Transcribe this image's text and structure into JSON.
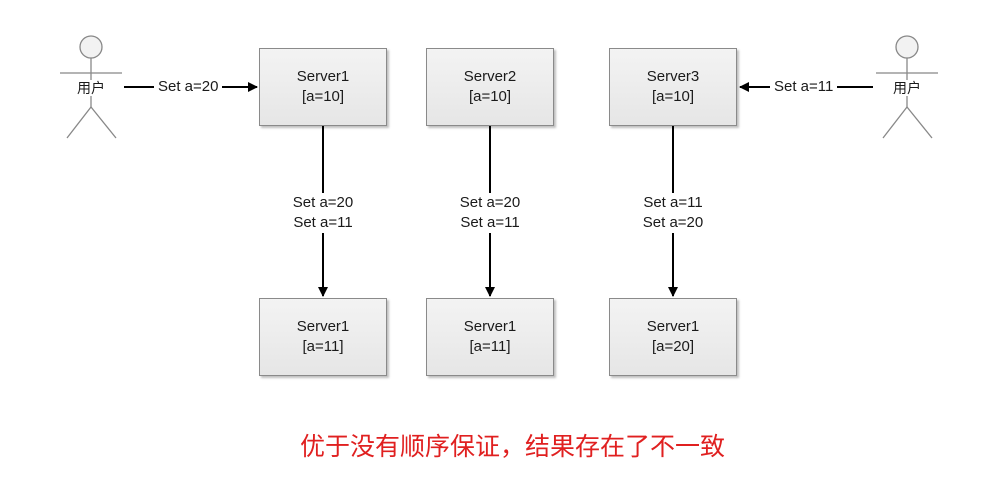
{
  "users": [
    {
      "label": "用户"
    },
    {
      "label": "用户"
    }
  ],
  "servers_top": [
    {
      "name": "Server1",
      "value": "[a=10]"
    },
    {
      "name": "Server2",
      "value": "[a=10]"
    },
    {
      "name": "Server3",
      "value": "[a=10]"
    }
  ],
  "servers_bottom": [
    {
      "name": "Server1",
      "value": "[a=11]"
    },
    {
      "name": "Server1",
      "value": "[a=11]"
    },
    {
      "name": "Server1",
      "value": "[a=20]"
    }
  ],
  "user_requests": {
    "left": "Set a=20",
    "right": "Set a=11"
  },
  "sync_labels": [
    {
      "line1": "Set a=20",
      "line2": "Set a=11"
    },
    {
      "line1": "Set a=20",
      "line2": "Set a=11"
    },
    {
      "line1": "Set a=11",
      "line2": "Set a=20"
    }
  ],
  "caption": "优于没有顺序保证，结果存在了不一致",
  "colors": {
    "caption": "#e02020",
    "box_fill": "#ececec",
    "box_border": "#8a8a8a",
    "stick_figure": "#888888",
    "arrow": "#000000"
  }
}
